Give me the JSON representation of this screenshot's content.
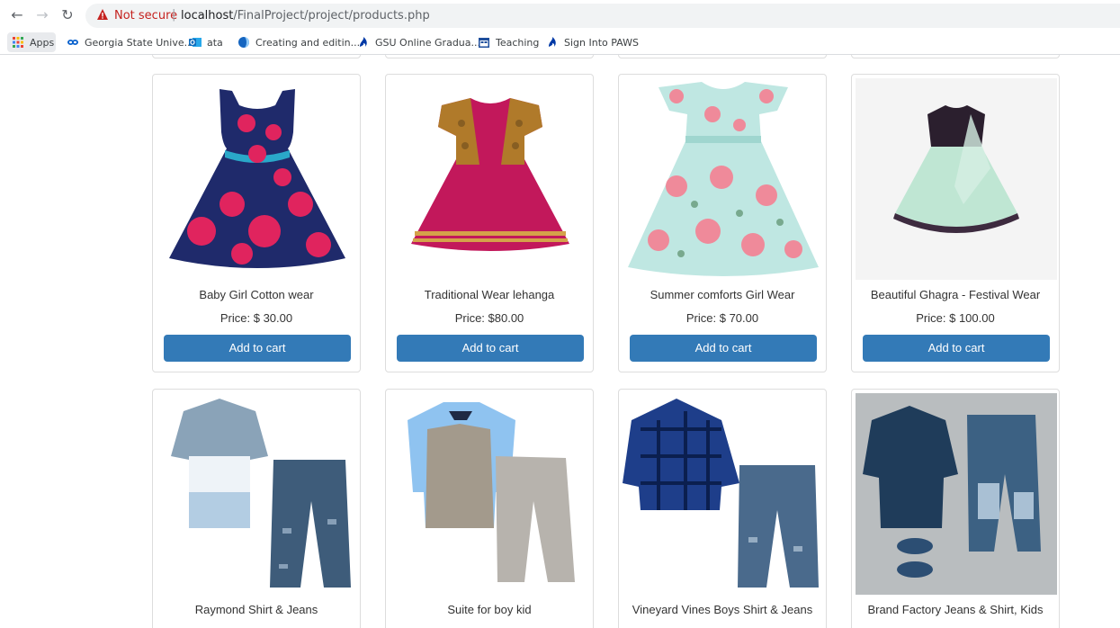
{
  "browser": {
    "security_label": "Not secure",
    "separator": "|",
    "url_host": "localhost",
    "url_path": "/FinalProject/project/products.php"
  },
  "bookmarks": [
    {
      "label": "Apps",
      "icon": "apps-grid-icon",
      "color": "#1a73e8"
    },
    {
      "label": "Georgia State Unive...",
      "icon": "link-icon",
      "color": "#0b63ce"
    },
    {
      "label": "ata",
      "icon": "outlook-icon",
      "color": "#0f6cbd"
    },
    {
      "label": "Creating and editin...",
      "icon": "globe-icon",
      "color": "#1565c0"
    },
    {
      "label": "GSU Online Gradua...",
      "icon": "gsu-flame-icon",
      "color": "#0039a6"
    },
    {
      "label": "Teaching",
      "icon": "calendar-icon",
      "color": "#1e4e9c"
    },
    {
      "label": "Sign Into PAWS",
      "icon": "gsu-flame-icon",
      "color": "#0039a6"
    }
  ],
  "products": [
    {
      "name": "Baby Girl Cotton wear",
      "price": "Price: $ 30.00",
      "button": "Add to cart"
    },
    {
      "name": "Traditional Wear lehanga",
      "price": "Price: $80.00",
      "button": "Add to cart"
    },
    {
      "name": "Summer comforts Girl Wear",
      "price": "Price: $ 70.00",
      "button": "Add to cart"
    },
    {
      "name": "Beautiful Ghagra - Festival Wear",
      "price": "Price: $ 100.00",
      "button": "Add to cart"
    },
    {
      "name": "Raymond Shirt & Jeans"
    },
    {
      "name": "Suite for boy kid"
    },
    {
      "name": "Vineyard Vines Boys Shirt & Jeans"
    },
    {
      "name": "Brand Factory Jeans & Shirt, Kids"
    }
  ],
  "colors": {
    "button": "#337ab7",
    "not_secure": "#c5221f"
  }
}
